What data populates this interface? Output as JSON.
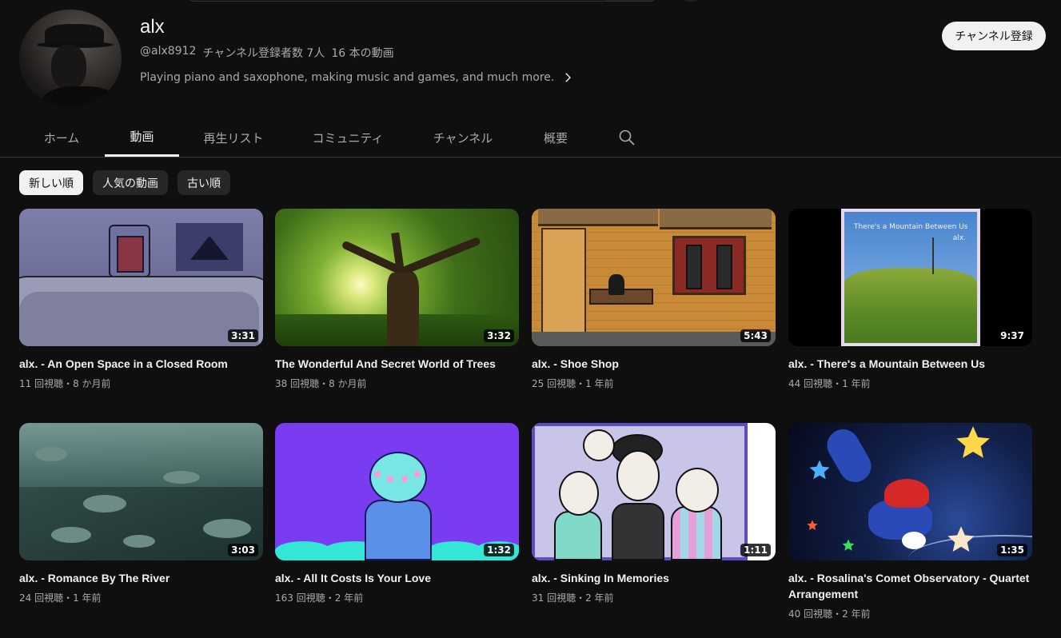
{
  "channel": {
    "name": "alx",
    "handle": "@alx8912",
    "subscribers": "チャンネル登録者数 7人",
    "video_count": "16 本の動画",
    "description": "Playing piano and saxophone, making music and games, and much more.",
    "subscribe_label": "チャンネル登録"
  },
  "tabs": [
    {
      "label": "ホーム"
    },
    {
      "label": "動画",
      "active": true
    },
    {
      "label": "再生リスト"
    },
    {
      "label": "コミュニティ"
    },
    {
      "label": "チャンネル"
    },
    {
      "label": "概要"
    }
  ],
  "filters": [
    {
      "label": "新しい順",
      "active": true
    },
    {
      "label": "人気の動画"
    },
    {
      "label": "古い順"
    }
  ],
  "videos": [
    {
      "title": "alx. - An Open Space in a Closed Room",
      "views": "11 回視聴",
      "age": "8 か月前",
      "duration": "3:31"
    },
    {
      "title": "The Wonderful And Secret World of Trees",
      "views": "38 回視聴",
      "age": "8 か月前",
      "duration": "3:32"
    },
    {
      "title": "alx. - Shoe Shop",
      "views": "25 回視聴",
      "age": "1 年前",
      "duration": "5:43"
    },
    {
      "title": "alx. - There's a Mountain Between Us",
      "views": "44 回視聴",
      "age": "1 年前",
      "duration": "9:37",
      "thumb_text": [
        "There's a Mountain Between Us",
        "alx."
      ]
    },
    {
      "title": "alx. - Romance By The River",
      "views": "24 回視聴",
      "age": "1 年前",
      "duration": "3:03"
    },
    {
      "title": "alx. - All It Costs Is Your Love",
      "views": "163 回視聴",
      "age": "2 年前",
      "duration": "1:32"
    },
    {
      "title": "alx. - Sinking In Memories",
      "views": "31 回視聴",
      "age": "2 年前",
      "duration": "1:11"
    },
    {
      "title": "alx. - Rosalina's Comet Observatory - Quartet Arrangement",
      "views": "40 回視聴",
      "age": "2 年前",
      "duration": "1:35"
    }
  ],
  "meta_separator": "・",
  "icons": {
    "tab_search": "search-icon",
    "description_more": "chevron-right-icon"
  },
  "colors": {
    "background": "#0f0f0f",
    "text_primary": "#f1f1f1",
    "text_secondary": "#aaaaaa",
    "chip_bg": "#272727"
  }
}
